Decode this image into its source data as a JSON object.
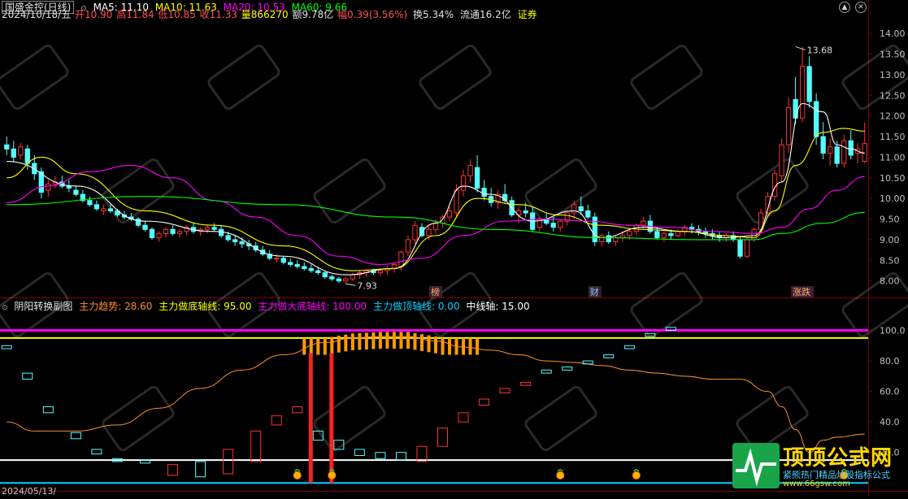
{
  "colors": {
    "up": "#ff3232",
    "down": "#54ffff",
    "ma5": "#ffffff",
    "ma10": "#ffff00",
    "ma20": "#ff00ff",
    "ma60": "#00ff00",
    "grid": "#7a0000",
    "axis_text": "#c0c0c0",
    "trend": "#ff8c28",
    "bottom_line": "#ff00ff",
    "deep_bottom_line": "#ffff00",
    "top_line": "#00d2ff",
    "mid_line": "#ffffff",
    "bar_orange": "#ff9a00",
    "signal_red": "#ff2020"
  },
  "main_header": {
    "name": "国盛金控(日线)",
    "ma5": "MA5: 11.10",
    "ma10": "MA10: 11.63",
    "ma20": "MA20: 10.53",
    "ma60": "MA60: 9.66",
    "date": "2024/10/18/五",
    "open": "开10.90",
    "high": "高11.84",
    "low": "低10.85",
    "close": "收11.33",
    "volume": "量866270",
    "amount": "额9.78亿",
    "change": "幅0.39(3.56%)",
    "turnover": "换5.34%",
    "float_cap": "流通16.2亿",
    "tag": "证券"
  },
  "sub_header": {
    "name": "阴阳转换副图",
    "trend": "主力趋势: 28.60",
    "bottom_axis": "主力做底轴线: 95.00",
    "deep_bottom_axis": "主力做大底轴线: 100.00",
    "top_axis": "主力做顶轴线: 0.00",
    "mid_axis": "中线轴: 15.00"
  },
  "bottom_date": "2024/05/13/",
  "window_buttons": {
    "up_icon": "▲",
    "close_icon": "✕"
  },
  "watermark": {
    "brand": "顶顶公式网",
    "line1": "紧熊热门精品炒股指标公式",
    "line2": "www.66gsw.com"
  },
  "chart_data": [
    {
      "type": "candlestick",
      "title": "国盛金控(日线)",
      "ylim": [
        7.6,
        14.3
      ],
      "yticks": [
        8.0,
        8.5,
        9.0,
        9.5,
        10.0,
        10.5,
        11.0,
        11.5,
        12.0,
        12.5,
        13.0,
        13.5,
        14.0
      ],
      "annotations": [
        {
          "text": "13.68",
          "index": 114,
          "value": 13.68
        },
        {
          "text": "7.93",
          "index": 49,
          "value": 7.93
        }
      ],
      "event_tags": [
        {
          "text": "榜",
          "index": 62
        },
        {
          "text": "财",
          "index": 85
        },
        {
          "text": "涨跌",
          "index": 115
        }
      ],
      "ohlc": [
        [
          11.3,
          11.5,
          11.05,
          11.2
        ],
        [
          11.2,
          11.4,
          10.9,
          11.0
        ],
        [
          11.05,
          11.35,
          10.95,
          11.25
        ],
        [
          11.2,
          11.3,
          10.7,
          10.85
        ],
        [
          10.85,
          11.05,
          10.45,
          10.6
        ],
        [
          10.65,
          10.75,
          10.0,
          10.15
        ],
        [
          10.2,
          10.45,
          10.05,
          10.35
        ],
        [
          10.35,
          10.55,
          10.25,
          10.4
        ],
        [
          10.4,
          10.55,
          10.25,
          10.3
        ],
        [
          10.3,
          10.45,
          10.15,
          10.25
        ],
        [
          10.2,
          10.3,
          10.05,
          10.1
        ],
        [
          10.1,
          10.2,
          9.9,
          9.95
        ],
        [
          9.95,
          10.05,
          9.8,
          9.85
        ],
        [
          9.85,
          9.95,
          9.7,
          9.75
        ],
        [
          9.7,
          9.85,
          9.6,
          9.75
        ],
        [
          9.75,
          9.85,
          9.65,
          9.7
        ],
        [
          9.7,
          9.75,
          9.55,
          9.6
        ],
        [
          9.6,
          9.7,
          9.5,
          9.55
        ],
        [
          9.55,
          9.65,
          9.45,
          9.5
        ],
        [
          9.5,
          9.55,
          9.3,
          9.35
        ],
        [
          9.35,
          9.45,
          9.2,
          9.25
        ],
        [
          9.25,
          9.3,
          9.0,
          9.05
        ],
        [
          9.05,
          9.2,
          8.95,
          9.15
        ],
        [
          9.15,
          9.3,
          9.05,
          9.25
        ],
        [
          9.25,
          9.35,
          9.1,
          9.15
        ],
        [
          9.15,
          9.25,
          9.05,
          9.2
        ],
        [
          9.2,
          9.35,
          9.1,
          9.3
        ],
        [
          9.3,
          9.4,
          9.15,
          9.2
        ],
        [
          9.2,
          9.3,
          9.1,
          9.25
        ],
        [
          9.25,
          9.35,
          9.15,
          9.3
        ],
        [
          9.3,
          9.4,
          9.2,
          9.25
        ],
        [
          9.25,
          9.35,
          9.05,
          9.1
        ],
        [
          9.1,
          9.2,
          8.95,
          9.0
        ],
        [
          9.0,
          9.1,
          8.85,
          8.95
        ],
        [
          8.95,
          9.05,
          8.8,
          8.9
        ],
        [
          8.9,
          9.0,
          8.75,
          8.85
        ],
        [
          8.85,
          8.95,
          8.7,
          8.75
        ],
        [
          8.75,
          8.85,
          8.6,
          8.65
        ],
        [
          8.65,
          8.75,
          8.5,
          8.55
        ],
        [
          8.55,
          8.65,
          8.45,
          8.55
        ],
        [
          8.55,
          8.6,
          8.4,
          8.45
        ],
        [
          8.45,
          8.55,
          8.35,
          8.4
        ],
        [
          8.4,
          8.5,
          8.3,
          8.35
        ],
        [
          8.35,
          8.45,
          8.25,
          8.3
        ],
        [
          8.3,
          8.4,
          8.2,
          8.25
        ],
        [
          8.25,
          8.35,
          8.15,
          8.2
        ],
        [
          8.2,
          8.25,
          8.05,
          8.1
        ],
        [
          8.1,
          8.15,
          8.0,
          8.05
        ],
        [
          8.05,
          8.1,
          7.95,
          8.0
        ],
        [
          8.0,
          8.1,
          7.93,
          8.05
        ],
        [
          8.05,
          8.2,
          8.0,
          8.15
        ],
        [
          8.15,
          8.25,
          8.05,
          8.2
        ],
        [
          8.2,
          8.3,
          8.1,
          8.25
        ],
        [
          8.25,
          8.3,
          8.15,
          8.2
        ],
        [
          8.2,
          8.3,
          8.12,
          8.25
        ],
        [
          8.25,
          8.35,
          8.15,
          8.3
        ],
        [
          8.3,
          8.45,
          8.2,
          8.4
        ],
        [
          8.35,
          8.75,
          8.25,
          8.7
        ],
        [
          8.7,
          9.1,
          8.6,
          9.0
        ],
        [
          9.0,
          9.45,
          8.9,
          9.35
        ],
        [
          9.3,
          9.4,
          9.05,
          9.1
        ],
        [
          9.1,
          9.35,
          9.0,
          9.25
        ],
        [
          9.25,
          9.5,
          9.15,
          9.4
        ],
        [
          9.4,
          9.6,
          9.3,
          9.55
        ],
        [
          9.55,
          9.8,
          9.45,
          9.7
        ],
        [
          9.65,
          10.35,
          9.55,
          10.2
        ],
        [
          10.2,
          10.7,
          10.05,
          10.55
        ],
        [
          10.55,
          10.95,
          10.4,
          10.8
        ],
        [
          10.75,
          11.05,
          10.15,
          10.25
        ],
        [
          10.25,
          10.45,
          9.95,
          10.05
        ],
        [
          10.05,
          10.25,
          9.8,
          9.9
        ],
        [
          9.9,
          10.2,
          9.75,
          10.1
        ],
        [
          10.1,
          10.35,
          9.9,
          9.95
        ],
        [
          9.95,
          10.05,
          9.55,
          9.6
        ],
        [
          9.6,
          9.8,
          9.4,
          9.7
        ],
        [
          9.7,
          9.9,
          9.55,
          9.65
        ],
        [
          9.65,
          9.8,
          9.2,
          9.25
        ],
        [
          9.3,
          9.55,
          9.2,
          9.5
        ],
        [
          9.5,
          9.65,
          9.35,
          9.4
        ],
        [
          9.4,
          9.55,
          9.2,
          9.3
        ],
        [
          9.3,
          9.5,
          9.2,
          9.45
        ],
        [
          9.45,
          9.7,
          9.35,
          9.65
        ],
        [
          9.65,
          9.95,
          9.5,
          9.85
        ],
        [
          9.8,
          10.05,
          9.6,
          9.7
        ],
        [
          9.7,
          9.85,
          9.5,
          9.55
        ],
        [
          9.55,
          9.65,
          8.85,
          8.95
        ],
        [
          8.95,
          9.15,
          8.85,
          9.1
        ],
        [
          9.1,
          9.2,
          8.9,
          8.95
        ],
        [
          8.95,
          9.1,
          8.85,
          9.05
        ],
        [
          9.05,
          9.2,
          8.95,
          9.1
        ],
        [
          9.1,
          9.25,
          9.0,
          9.2
        ],
        [
          9.2,
          9.4,
          9.1,
          9.35
        ],
        [
          9.35,
          9.55,
          9.25,
          9.45
        ],
        [
          9.45,
          9.6,
          9.15,
          9.2
        ],
        [
          9.2,
          9.3,
          9.0,
          9.05
        ],
        [
          9.05,
          9.2,
          8.95,
          9.15
        ],
        [
          9.15,
          9.25,
          9.0,
          9.1
        ],
        [
          9.1,
          9.25,
          9.05,
          9.2
        ],
        [
          9.2,
          9.35,
          9.1,
          9.3
        ],
        [
          9.3,
          9.4,
          9.15,
          9.25
        ],
        [
          9.25,
          9.35,
          9.1,
          9.2
        ],
        [
          9.2,
          9.3,
          9.05,
          9.15
        ],
        [
          9.15,
          9.25,
          9.0,
          9.1
        ],
        [
          9.1,
          9.2,
          8.95,
          9.05
        ],
        [
          9.05,
          9.15,
          8.95,
          9.1
        ],
        [
          9.1,
          9.2,
          8.95,
          9.0
        ],
        [
          9.0,
          9.1,
          8.55,
          8.6
        ],
        [
          8.6,
          9.05,
          8.55,
          9.0
        ],
        [
          9.0,
          9.3,
          8.95,
          9.25
        ],
        [
          9.25,
          9.75,
          9.15,
          9.65
        ],
        [
          9.65,
          10.15,
          9.55,
          10.05
        ],
        [
          10.05,
          10.7,
          9.95,
          10.6
        ],
        [
          10.55,
          11.45,
          10.4,
          11.3
        ],
        [
          11.3,
          12.45,
          11.1,
          12.2
        ],
        [
          12.4,
          12.95,
          11.8,
          11.95
        ],
        [
          11.95,
          13.68,
          11.85,
          13.2
        ],
        [
          13.2,
          13.45,
          12.2,
          12.35
        ],
        [
          12.35,
          12.55,
          11.3,
          11.5
        ],
        [
          11.5,
          11.85,
          10.95,
          11.1
        ],
        [
          11.1,
          11.45,
          10.8,
          11.25
        ],
        [
          11.25,
          11.4,
          10.75,
          10.85
        ],
        [
          10.85,
          11.55,
          10.75,
          11.4
        ],
        [
          11.4,
          11.65,
          10.95,
          11.05
        ],
        [
          11.1,
          11.35,
          10.85,
          11.2
        ],
        [
          10.9,
          11.84,
          10.85,
          11.33
        ]
      ],
      "ma": {
        "MA5": {
          "x": [
            0,
            10,
            20,
            30,
            40,
            49,
            56,
            62,
            66,
            70,
            76,
            82,
            86,
            92,
            98,
            104,
            108,
            112,
            115,
            118,
            120,
            122,
            124
          ],
          "y": [
            10.9,
            10.3,
            9.45,
            9.2,
            8.6,
            8.15,
            8.3,
            9.4,
            10.3,
            10.1,
            9.45,
            9.7,
            9.05,
            9.3,
            9.2,
            9.05,
            9.1,
            10.4,
            12.3,
            12.1,
            11.3,
            11.2,
            11.1
          ]
        },
        "MA10": {
          "x": [
            0,
            5,
            10,
            20,
            30,
            40,
            50,
            56,
            62,
            68,
            74,
            80,
            86,
            92,
            98,
            104,
            108,
            111,
            114,
            118,
            121,
            124
          ],
          "y": [
            10.5,
            11.0,
            10.6,
            9.7,
            9.35,
            8.85,
            8.25,
            8.3,
            9.1,
            10.0,
            9.85,
            9.6,
            9.35,
            9.25,
            9.2,
            9.1,
            9.05,
            9.7,
            10.8,
            11.6,
            11.7,
            11.63
          ]
        },
        "MA20": {
          "x": [
            0,
            6,
            12,
            18,
            24,
            30,
            36,
            42,
            48,
            54,
            60,
            66,
            72,
            78,
            84,
            90,
            96,
            102,
            108,
            112,
            116,
            120,
            124
          ],
          "y": [
            9.9,
            10.3,
            10.65,
            10.8,
            10.5,
            9.95,
            9.55,
            9.1,
            8.6,
            8.4,
            8.55,
            9.1,
            9.45,
            9.5,
            9.45,
            9.35,
            9.3,
            9.2,
            9.15,
            9.3,
            9.75,
            10.2,
            10.53
          ]
        },
        "MA60": {
          "x": [
            0,
            20,
            40,
            56,
            70,
            86,
            100,
            108,
            112,
            118,
            124
          ],
          "y": [
            9.85,
            10.05,
            9.85,
            9.55,
            9.25,
            9.05,
            9.0,
            9.0,
            9.15,
            9.4,
            9.66
          ]
        }
      }
    },
    {
      "type": "indicator",
      "title": "阴阳转换副图",
      "ylim": [
        -2,
        112
      ],
      "yticks": [
        20.0,
        40.0,
        60.0,
        80.0,
        100.0
      ],
      "levels": {
        "deep_bottom": 100,
        "bottom": 95,
        "mid": 15,
        "top": 0
      },
      "trend": {
        "x": [
          0,
          4,
          10,
          16,
          22,
          28,
          34,
          40,
          46,
          50,
          54,
          58,
          62,
          66,
          70,
          74,
          78,
          82,
          86,
          90,
          94,
          98,
          102,
          106,
          110,
          112,
          114,
          116,
          118,
          120,
          124
        ],
        "y": [
          40,
          34,
          34,
          38,
          49,
          62,
          74,
          84,
          92,
          95,
          96,
          96,
          93,
          89,
          87,
          84,
          80,
          79,
          77,
          74,
          72,
          70,
          68,
          68,
          60,
          50,
          35,
          20,
          28,
          30,
          32
        ]
      },
      "wave_boxes": [
        [
          0,
          90,
          88,
          "down"
        ],
        [
          3,
          72,
          68,
          "down"
        ],
        [
          6,
          50,
          46,
          "down"
        ],
        [
          10,
          33,
          29,
          "down"
        ],
        [
          13,
          22,
          19,
          "down"
        ],
        [
          16,
          16,
          14,
          "down"
        ],
        [
          20,
          15,
          13,
          "down"
        ],
        [
          24,
          12,
          5,
          "up"
        ],
        [
          28,
          14,
          4,
          "down"
        ],
        [
          32,
          22,
          6,
          "up"
        ],
        [
          36,
          34,
          14,
          "up"
        ],
        [
          39,
          44,
          38,
          "up"
        ],
        [
          42,
          50,
          46,
          "up"
        ],
        [
          45,
          34,
          28,
          "down"
        ],
        [
          48,
          28,
          22,
          "down"
        ],
        [
          51,
          22,
          18,
          "down"
        ],
        [
          54,
          20,
          16,
          "down"
        ],
        [
          57,
          20,
          15,
          "down"
        ],
        [
          60,
          24,
          14,
          "up"
        ],
        [
          63,
          36,
          24,
          "up"
        ],
        [
          66,
          46,
          40,
          "up"
        ],
        [
          69,
          55,
          51,
          "up"
        ],
        [
          72,
          62,
          59,
          "up"
        ],
        [
          75,
          66,
          64,
          "up"
        ],
        [
          78,
          74,
          72,
          "down"
        ],
        [
          81,
          76,
          74,
          "down"
        ],
        [
          84,
          80,
          78,
          "down"
        ],
        [
          87,
          84,
          82,
          "down"
        ],
        [
          90,
          90,
          88,
          "down"
        ],
        [
          93,
          98,
          96,
          "down"
        ],
        [
          96,
          102,
          100,
          "down"
        ]
      ]
    }
  ]
}
